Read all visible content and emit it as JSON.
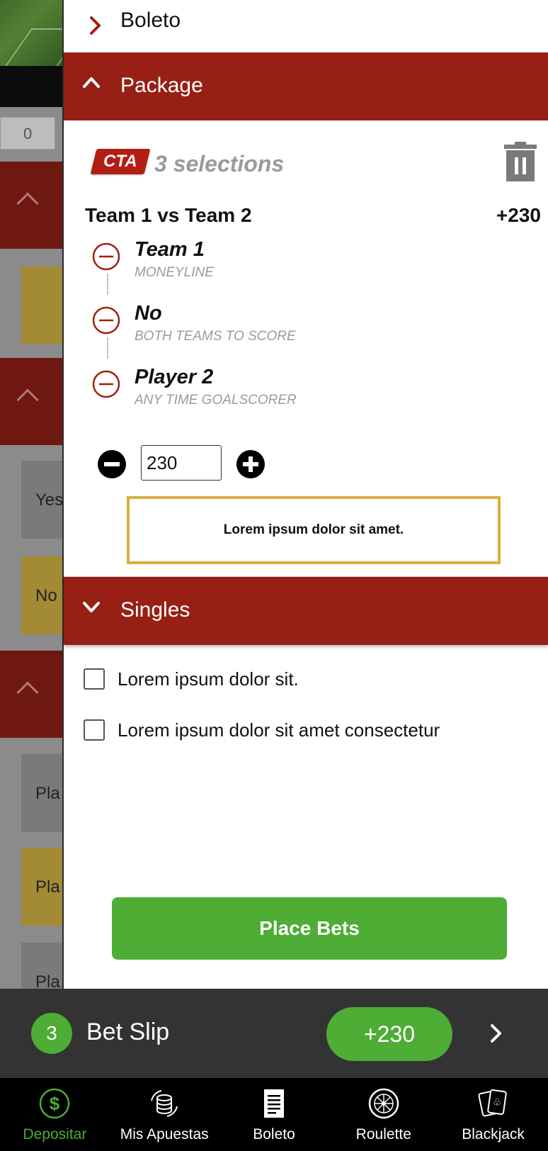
{
  "background": {
    "score_value": "0",
    "card_labels": [
      "Yes",
      "No",
      "Pla",
      "Pla",
      "Pla"
    ]
  },
  "drawer": {
    "boleto_label": "Boleto",
    "package": {
      "header_label": "Package",
      "badge": "CTA",
      "selections_label": "3 selections",
      "match_title": "Team 1 vs Team 2",
      "match_odds": "+230",
      "legs": [
        {
          "name": "Team 1",
          "market": "MONEYLINE"
        },
        {
          "name": "No",
          "market": "BOTH TEAMS TO SCORE"
        },
        {
          "name": "Player 2",
          "market": "ANY TIME GOALSCORER"
        }
      ],
      "stake_value": "230",
      "notice": "Lorem ipsum dolor sit amet."
    },
    "singles": {
      "header_label": "Singles",
      "options": [
        "Lorem ipsum dolor sit.",
        "Lorem ipsum dolor sit amet consectetur"
      ],
      "place_bets_label": "Place Bets"
    }
  },
  "betslip": {
    "count": "3",
    "title": "Bet Slip",
    "odds": "+230"
  },
  "nav": {
    "items": [
      {
        "label": "Depositar",
        "icon": "dollar-coin-icon",
        "active": true
      },
      {
        "label": "Mis Apuestas",
        "icon": "coin-stack-icon",
        "active": false
      },
      {
        "label": "Boleto",
        "icon": "document-icon",
        "active": false
      },
      {
        "label": "Roulette",
        "icon": "roulette-wheel-icon",
        "active": false
      },
      {
        "label": "Blackjack",
        "icon": "playing-cards-icon",
        "active": false
      }
    ]
  },
  "colors": {
    "brand_red": "#971f13",
    "accent_green": "#4dad34",
    "notice_border": "#ddae3f",
    "bar_dark": "#333333"
  }
}
